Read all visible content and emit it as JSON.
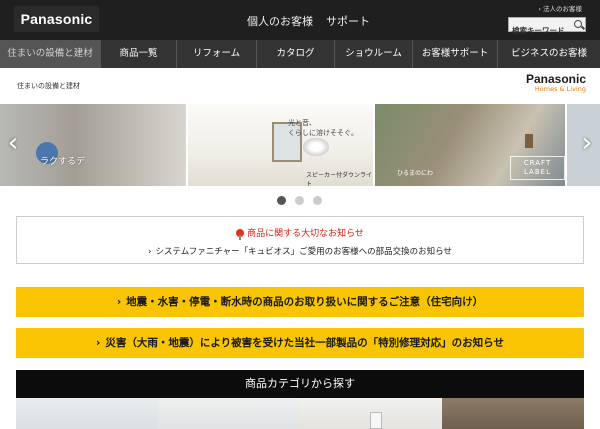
{
  "header": {
    "logo_text": "Panasonic",
    "corporate_link": "法人のお客様",
    "personal_link": "個人のお客様",
    "support_link": "サポート",
    "search_placeholder": "検索キーワード"
  },
  "nav": {
    "items": [
      {
        "label": "住まいの設備と建材"
      },
      {
        "label": "商品一覧"
      },
      {
        "label": "リフォーム"
      },
      {
        "label": "カタログ"
      },
      {
        "label": "ショウルーム"
      },
      {
        "label": "お客様サポート"
      },
      {
        "label": "ビジネスのお客様"
      }
    ]
  },
  "subheader": {
    "title": "住まいの設備と建材",
    "brand_name": "Panasonic",
    "brand_tagline": "Homes & Living"
  },
  "carousel": {
    "slide1_caption": "ラクするデ",
    "slide2_copy": "光と音、\nくらしに溶けそそぐ。",
    "slide2_caption": "スピーカー付ダウンライト",
    "slide3_caption": "ひるまのにわ",
    "slide3_label": "CRAFT LABEL",
    "active_slide": 1,
    "slide_count": 3
  },
  "notice": {
    "title": "商品に関する大切なお知らせ",
    "link": "システムファニチャー「キュビオス」ご愛用のお客様への部品交換のお知らせ"
  },
  "banners": {
    "banner1": "地震・水害・停電・断水時の商品のお取り扱いに関するご注意（住宅向け）",
    "banner2": "災害（大雨・地震）により被害を受けた当社一部製品の「特別修理対応」のお知らせ"
  },
  "category": {
    "header": "商品カテゴリから探す"
  },
  "colors": {
    "header_bg": "#1f1f1f",
    "nav_bg": "#333333",
    "banner_yellow": "#f9c401",
    "notice_red": "#d8200f",
    "brand_orange": "#e8780a"
  }
}
